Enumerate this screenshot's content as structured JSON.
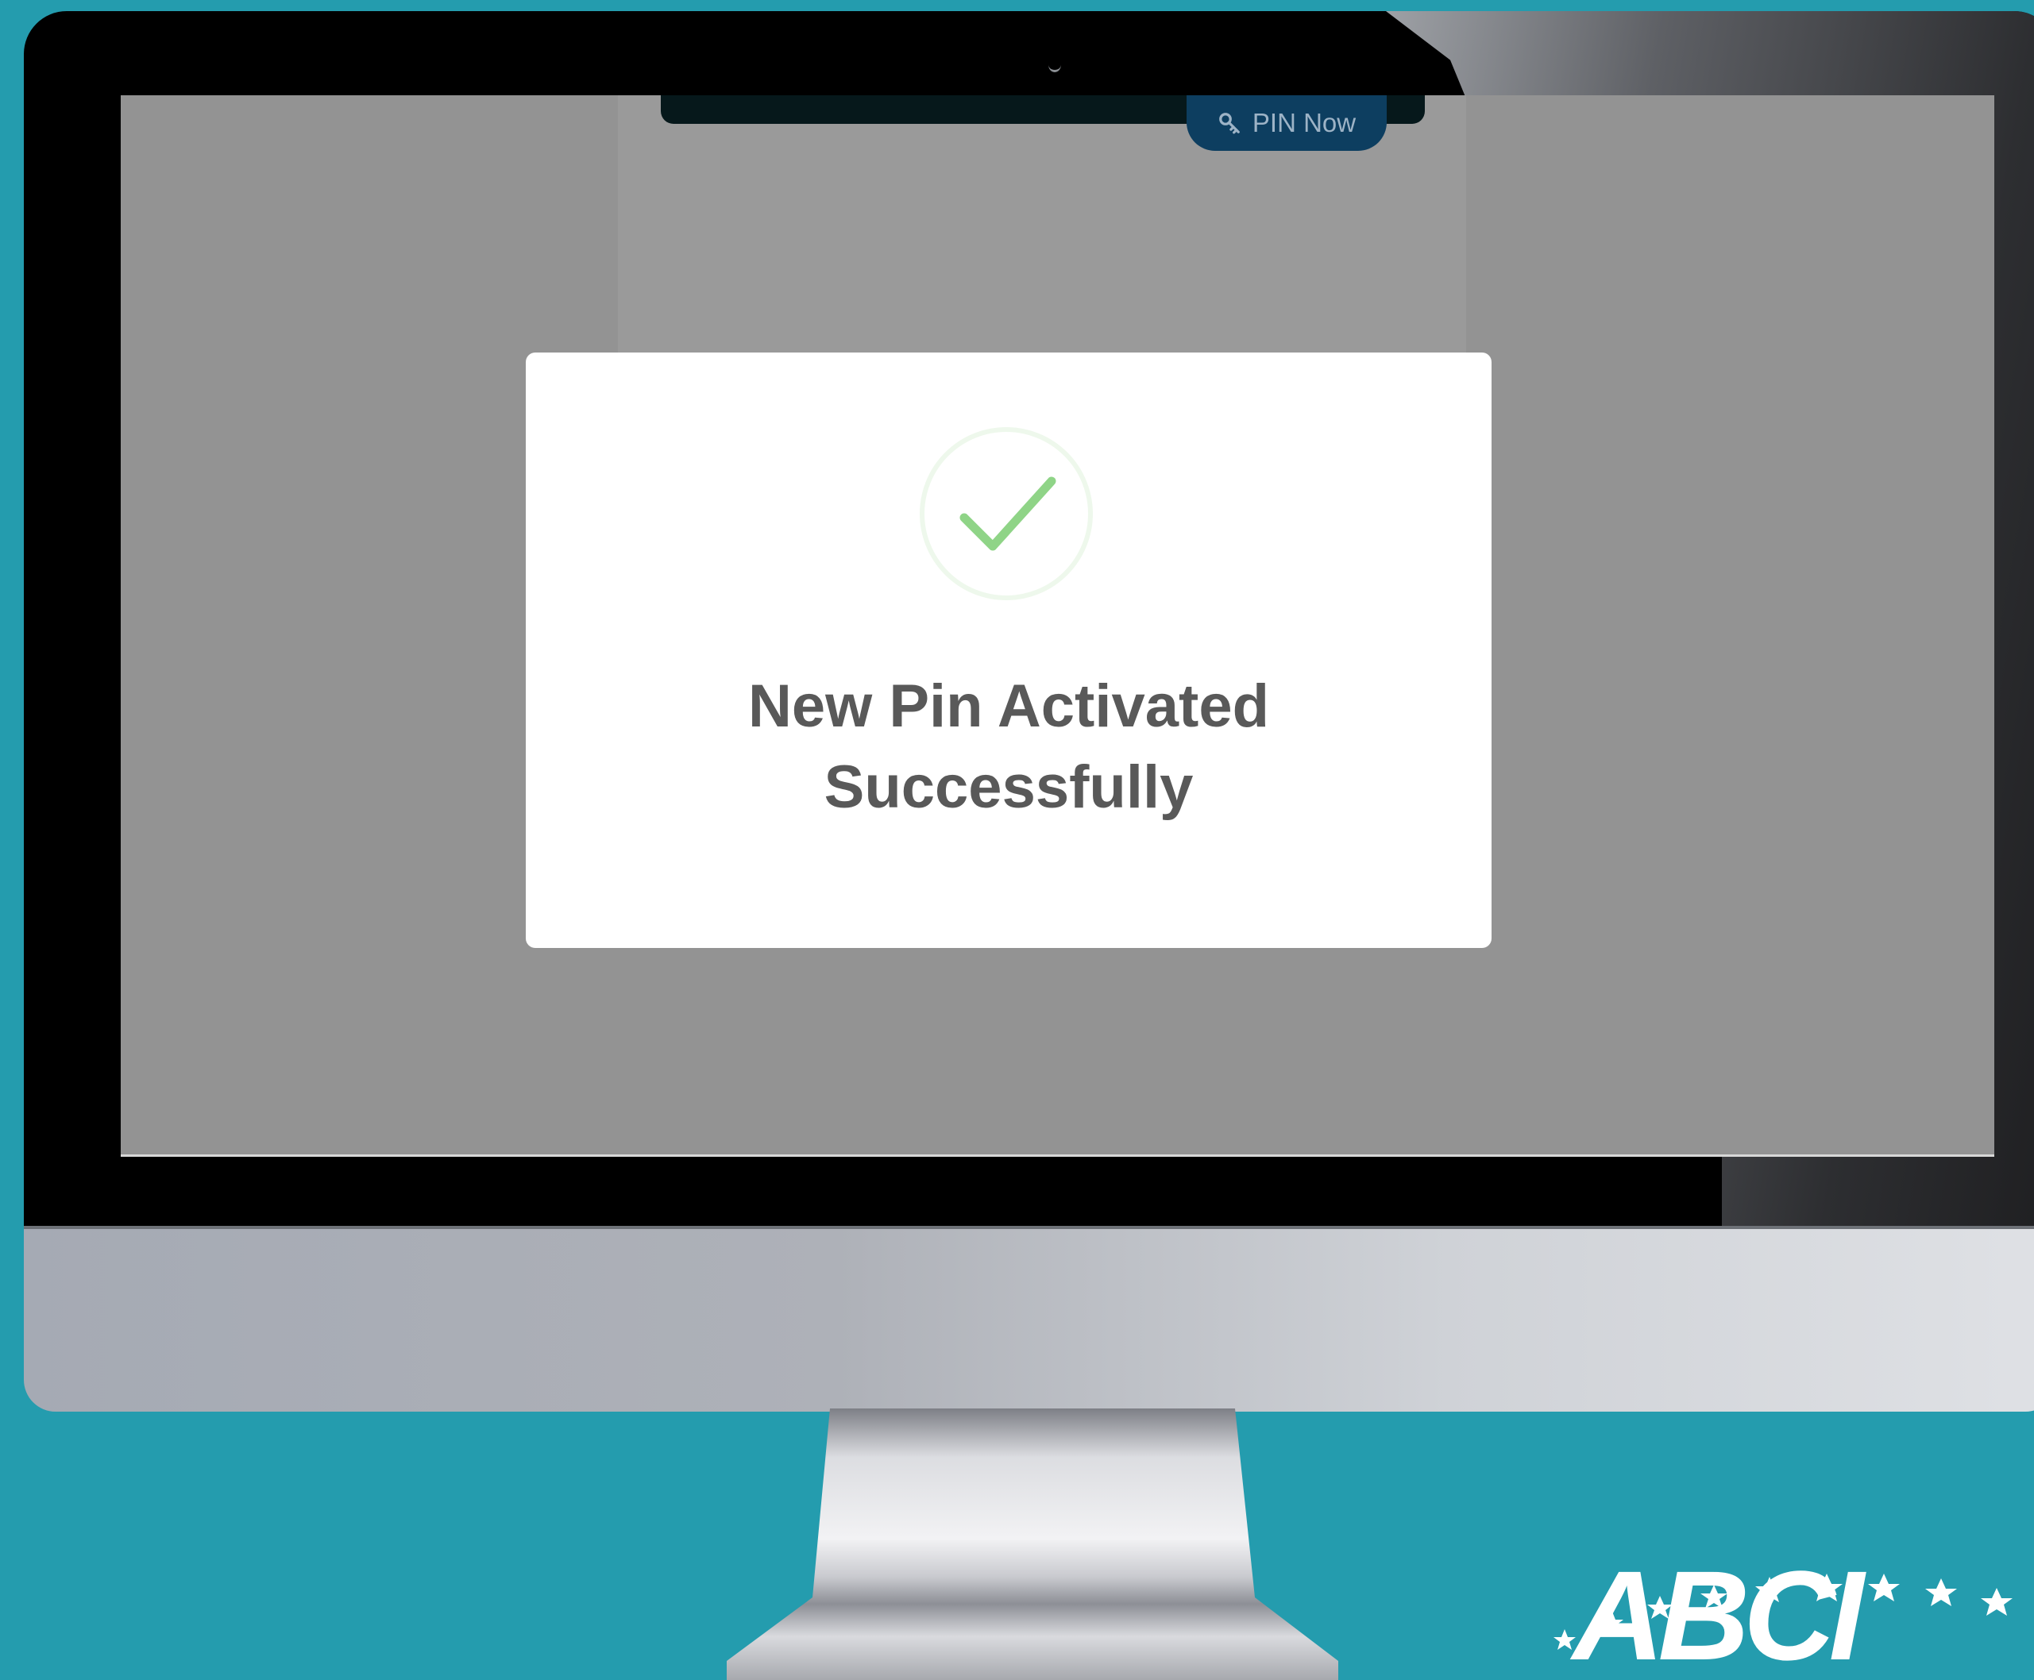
{
  "app": {
    "pin_button_label": "PIN Now"
  },
  "modal": {
    "title": "New Pin Activated\nSuccessfully",
    "icon": "check-circle-icon",
    "icon_color": "#8fd487"
  },
  "colors": {
    "background": "#249cae",
    "screen_overlay": "#939393",
    "pin_button": "#0d3e60",
    "title_text": "#595959"
  },
  "emblem": {
    "logo_text": "ABCI"
  }
}
